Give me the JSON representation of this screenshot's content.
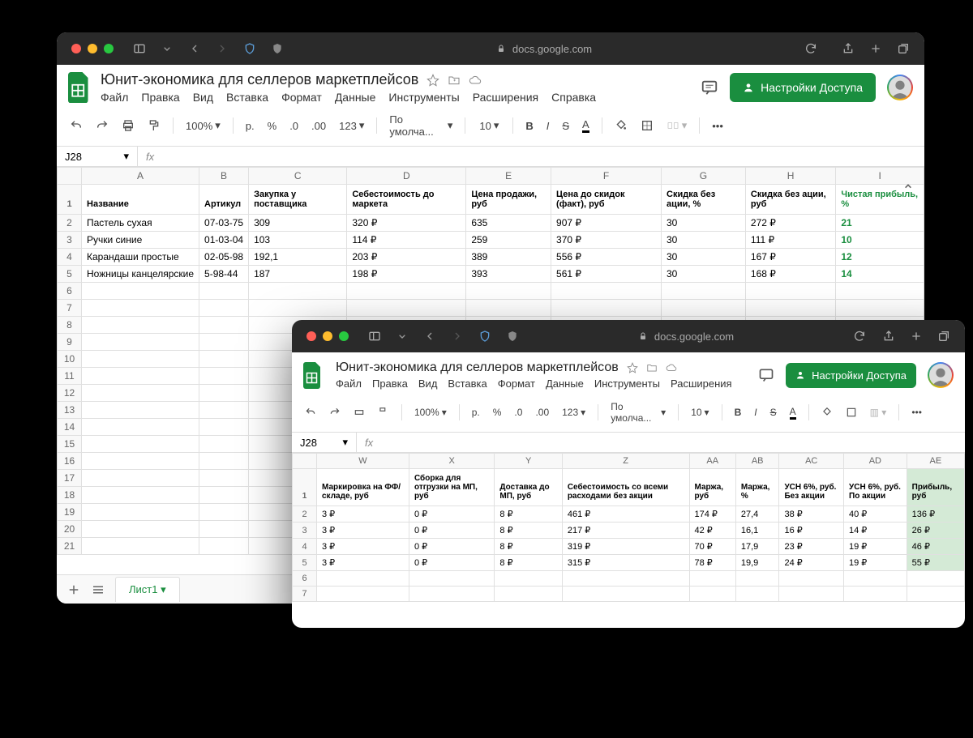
{
  "browser": {
    "url": "docs.google.com",
    "lock": "🔒"
  },
  "doc": {
    "title": "Юнит-экономика для селлеров маркетплейсов",
    "menus": [
      "Файл",
      "Правка",
      "Вид",
      "Вставка",
      "Формат",
      "Данные",
      "Инструменты",
      "Расширения",
      "Справка"
    ],
    "menus_short": [
      "Файл",
      "Правка",
      "Вид",
      "Вставка",
      "Формат",
      "Данные",
      "Инструменты",
      "Расширения"
    ],
    "share": "Настройки Доступа"
  },
  "toolbar": {
    "zoom": "100%",
    "currency": "р.",
    "percent": "%",
    "dec1": ".0",
    "dec2": ".00",
    "fmt": "123",
    "font": "По умолча...",
    "size": "10"
  },
  "cellref": "J28",
  "sheet_tab": "Лист1",
  "grid1": {
    "cols": [
      "A",
      "B",
      "C",
      "D",
      "E",
      "F",
      "G",
      "H",
      "I"
    ],
    "headers": [
      "Название",
      "Артикул",
      "Закупка у поставщика",
      "Себестоимость до маркета",
      "Цена продажи, руб",
      "Цена до скидок (факт), руб",
      "Скидка без ации, %",
      "Скидка без ации, руб",
      "Чистая прибыль, %"
    ],
    "rows": [
      [
        "Пастель сухая",
        "07-03-75",
        "309",
        "320 ₽",
        "635",
        "907 ₽",
        "30",
        "272 ₽",
        "21"
      ],
      [
        "Ручки синие",
        "01-03-04",
        "103",
        "114 ₽",
        "259",
        "370 ₽",
        "30",
        "111 ₽",
        "10"
      ],
      [
        "Карандаши простые",
        "02-05-98",
        "192,1",
        "203 ₽",
        "389",
        "556 ₽",
        "30",
        "167 ₽",
        "12"
      ],
      [
        "Ножницы канцелярские",
        "5-98-44",
        "187",
        "198 ₽",
        "393",
        "561 ₽",
        "30",
        "168 ₽",
        "14"
      ]
    ]
  },
  "grid2": {
    "cols": [
      "W",
      "X",
      "Y",
      "Z",
      "AA",
      "AB",
      "AC",
      "AD",
      "AE"
    ],
    "headers": [
      "Маркировка на ФФ/складе, руб",
      "Сборка для отгрузки на МП, руб",
      "Доставка до МП, руб",
      "Себестоимость со всеми расходами без акции",
      "Маржа, руб",
      "Маржа, %",
      "УСН 6%, руб. Без акции",
      "УСН 6%, руб. По акции",
      "Прибыль, руб"
    ],
    "rows": [
      [
        "3 ₽",
        "0 ₽",
        "8 ₽",
        "461 ₽",
        "174 ₽",
        "27,4",
        "38 ₽",
        "40 ₽",
        "136 ₽"
      ],
      [
        "3 ₽",
        "0 ₽",
        "8 ₽",
        "217 ₽",
        "42 ₽",
        "16,1",
        "16 ₽",
        "14 ₽",
        "26 ₽"
      ],
      [
        "3 ₽",
        "0 ₽",
        "8 ₽",
        "319 ₽",
        "70 ₽",
        "17,9",
        "23 ₽",
        "19 ₽",
        "46 ₽"
      ],
      [
        "3 ₽",
        "0 ₽",
        "8 ₽",
        "315 ₽",
        "78 ₽",
        "19,9",
        "24 ₽",
        "19 ₽",
        "55 ₽"
      ]
    ]
  }
}
